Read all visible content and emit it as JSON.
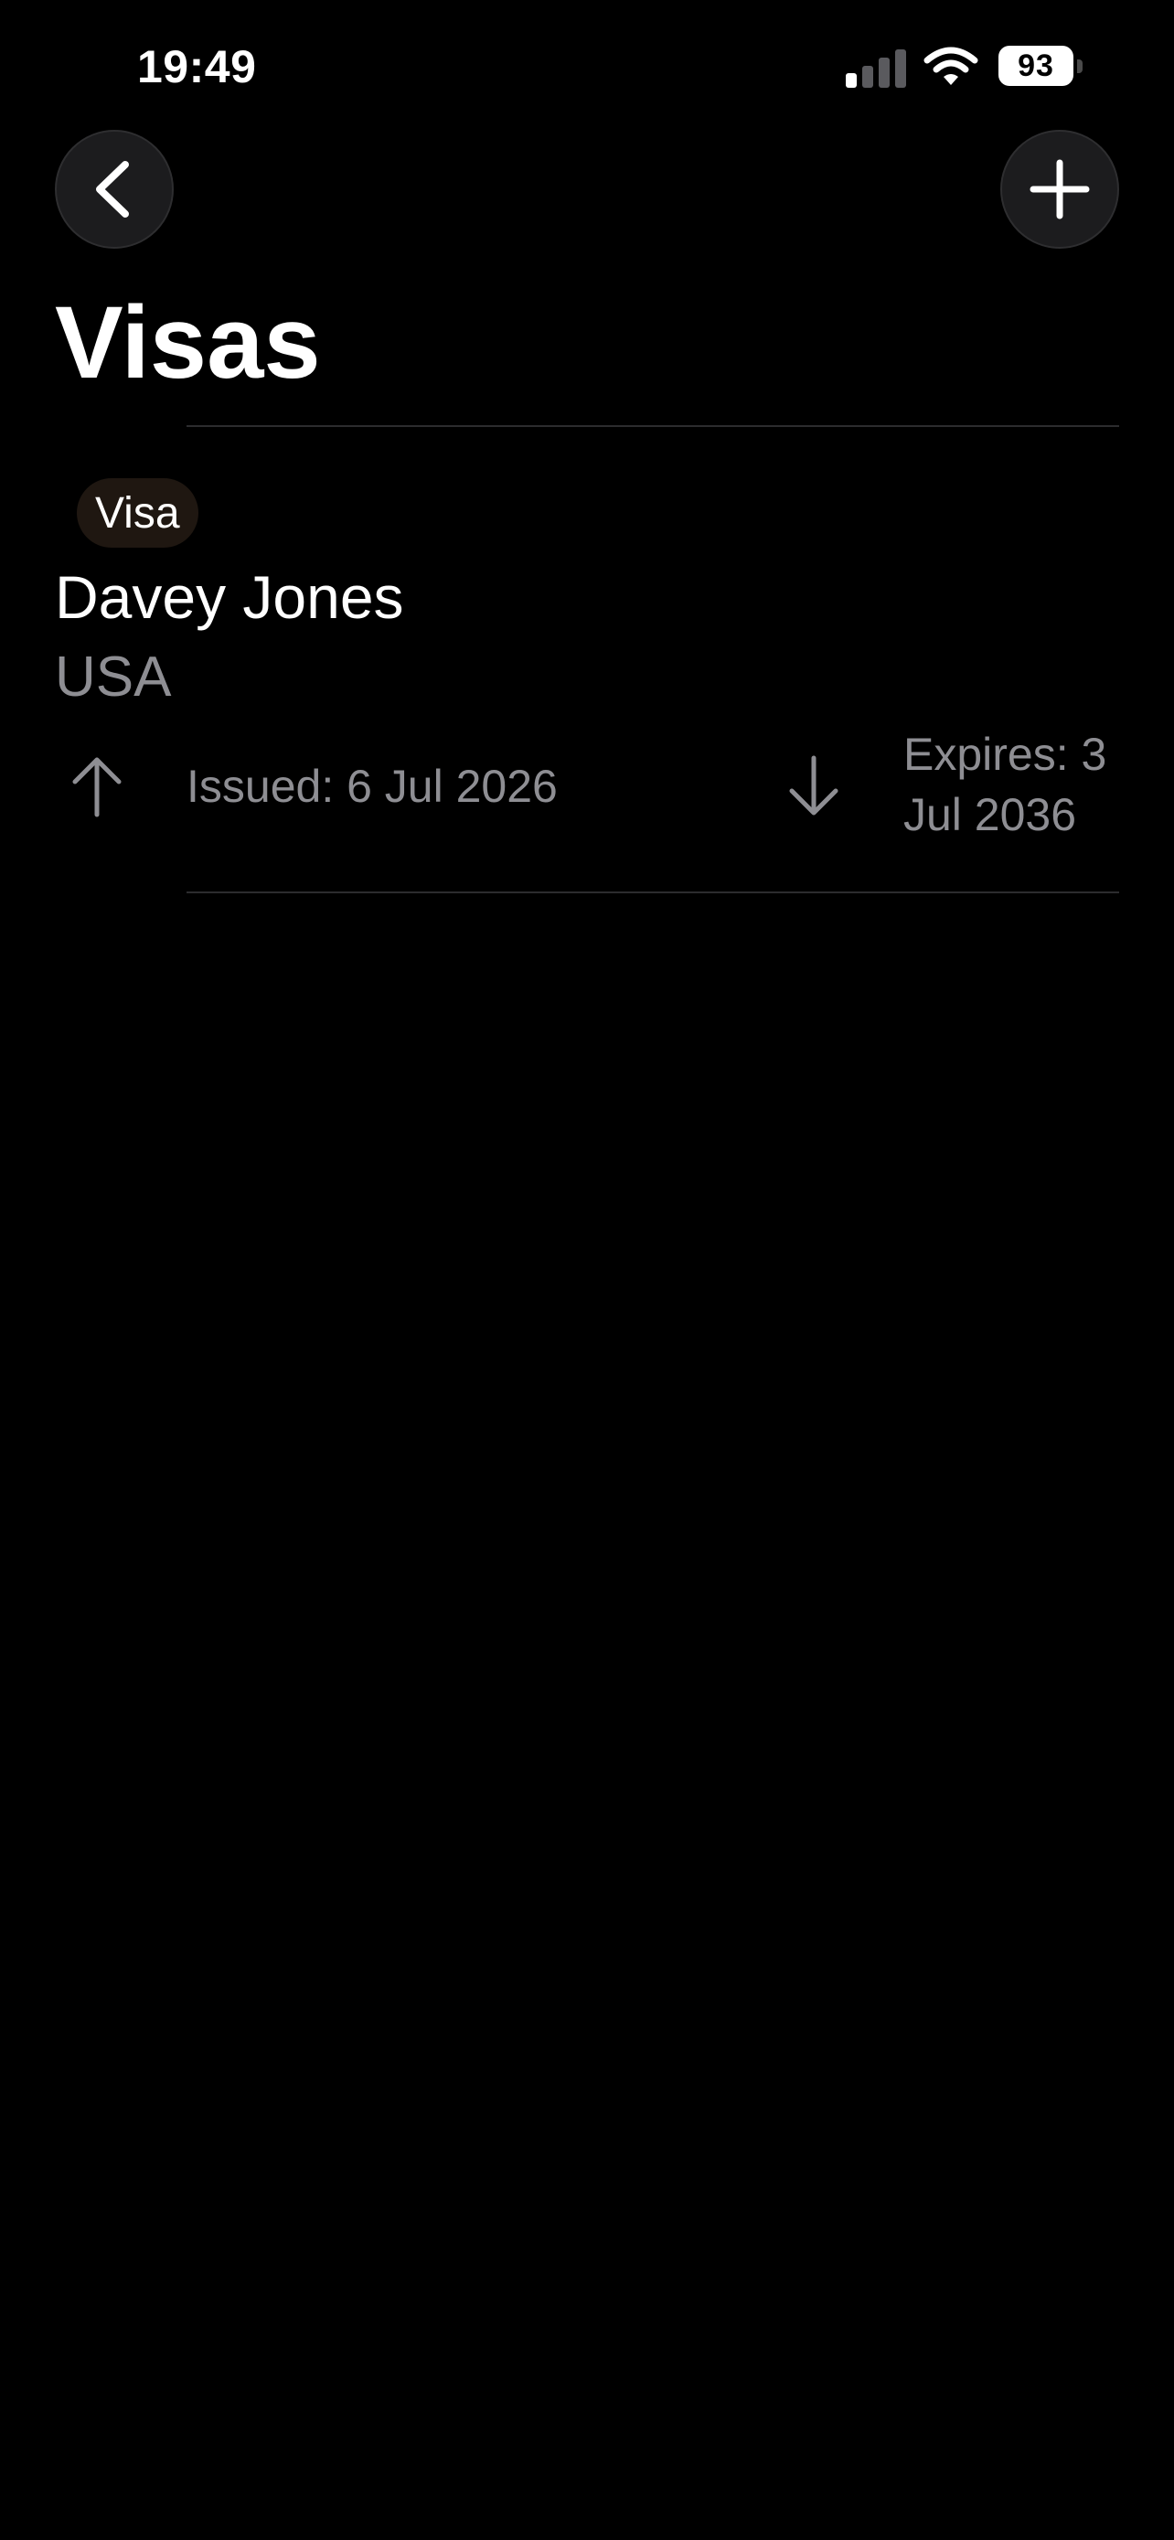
{
  "status_bar": {
    "time": "19:49",
    "battery_level": "93",
    "icons": [
      "cellular-signal-icon",
      "wifi-icon",
      "battery-icon"
    ]
  },
  "navigation": {
    "back_icon": "chevron-left-icon",
    "add_icon": "plus-icon"
  },
  "page": {
    "title": "Visas"
  },
  "visas": [
    {
      "badge": "Visa",
      "name": "Davey Jones",
      "country": "USA",
      "issued": "Issued: 6 Jul 2026",
      "expires": "Expires: 3 Jul 2036",
      "issued_icon": "arrow-up-icon",
      "expires_icon": "arrow-down-icon"
    }
  ],
  "colors": {
    "background": "#000000",
    "text_primary": "#ffffff",
    "text_secondary": "#8e8e93",
    "button_bg": "#1c1c1e",
    "badge_bg": "#1f1711",
    "divider": "#2c2c2e"
  }
}
